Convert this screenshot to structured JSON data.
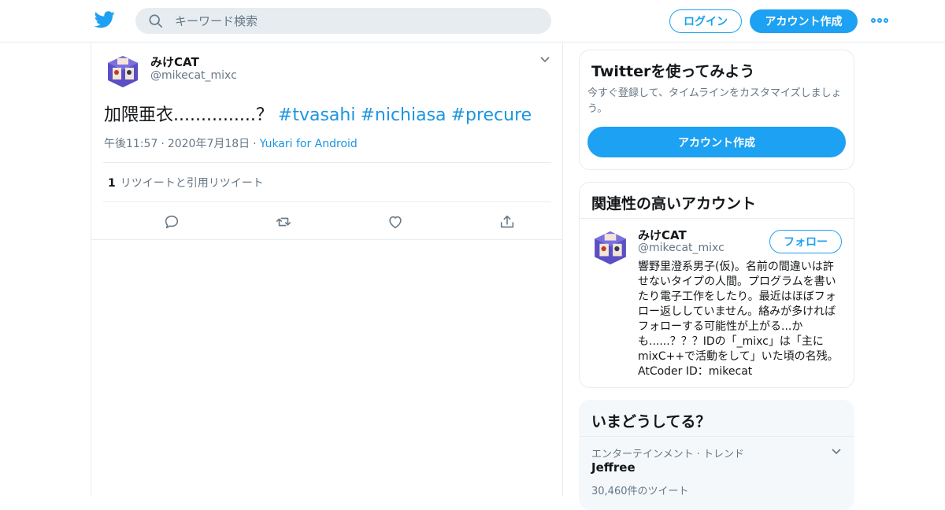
{
  "header": {
    "search_placeholder": "キーワード検索",
    "login_label": "ログイン",
    "signup_label": "アカウント作成"
  },
  "tweet": {
    "author_name": "みけCAT",
    "author_handle": "@mikecat_mixc",
    "text": "加隈亜衣...............？",
    "hashtags": [
      "#tvasahi",
      "#nichiasa",
      "#precure"
    ],
    "time": "午後11:57",
    "date": "2020年7月18日",
    "via": "Yukari for Android",
    "retweet_count": "1",
    "retweet_label": "リツイートと引用リツイート"
  },
  "signup_card": {
    "title": "Twitterを使ってみよう",
    "description": "今すぐ登録して、タイムラインをカスタマイズしましょう。",
    "button_label": "アカウント作成"
  },
  "related": {
    "title": "関連性の高いアカウント",
    "name": "みけCAT",
    "handle": "@mikecat_mixc",
    "follow_label": "フォロー",
    "bio": "響野里澄系男子(仮)。名前の間違いは許せないタイプの人間。プログラムを書いたり電子工作をしたり。最近はほぼフォロー返ししていません。絡みが多ければフォローする可能性が上がる...かも......？？？IDの「_mixc」は「主にmixC++で活動をして」いた頃の名残。AtCoder ID：mikecat"
  },
  "trends": {
    "title": "いまどうしてる？",
    "category": "エンターテインメント · トレンド",
    "name": "Jeffree",
    "count": "30,460件のツイート"
  },
  "colors": {
    "accent": "#1da1f2",
    "link": "#1b95e0",
    "secondary_text": "#657786",
    "border": "#e6ecf0"
  },
  "icons": [
    "twitter-bird-icon",
    "search-icon",
    "more-icon",
    "chevron-down-icon",
    "reply-icon",
    "retweet-icon",
    "like-icon",
    "share-icon"
  ]
}
